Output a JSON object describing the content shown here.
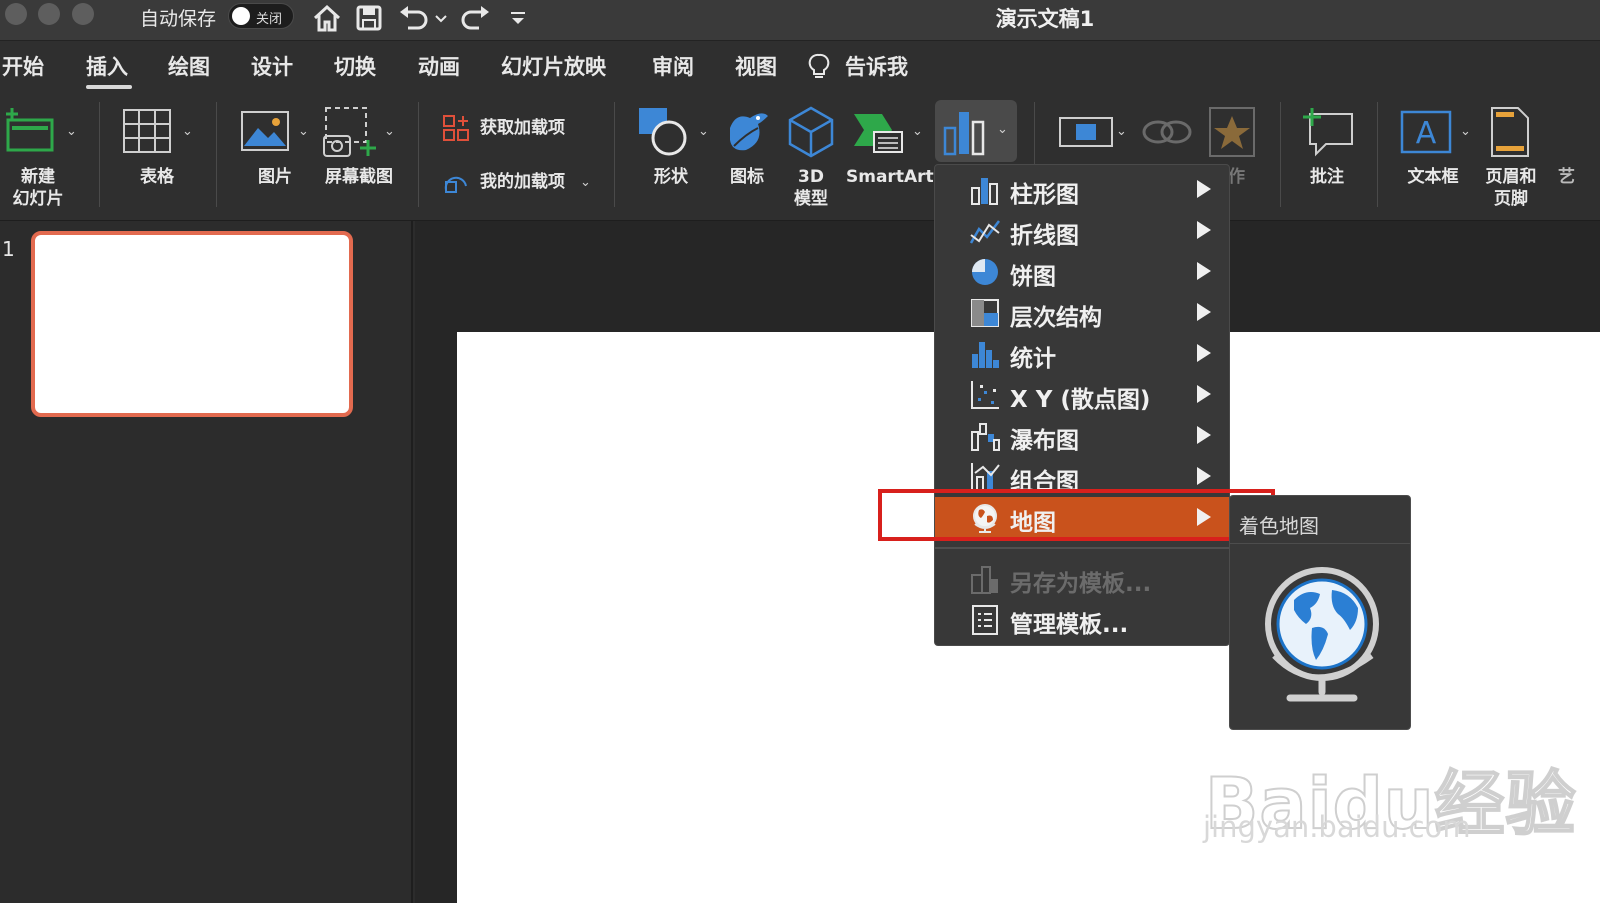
{
  "titlebar": {
    "autosave_label": "自动保存",
    "autosave_toggle": "关闭",
    "doc_title": "演示文稿1"
  },
  "tabs": [
    "开始",
    "插入",
    "绘图",
    "设计",
    "切换",
    "动画",
    "幻灯片放映",
    "审阅",
    "视图",
    "告诉我"
  ],
  "ribbon": {
    "new_slide": "新建\n幻灯片",
    "table": "表格",
    "picture": "图片",
    "screenshot": "屏幕截图",
    "get_addins": "获取加载项",
    "my_addins": "我的加载项",
    "shapes": "形状",
    "icons": "图标",
    "model3d": "3D\n模型",
    "smartart": "SmartArt",
    "action_partial": "作",
    "comment": "批注",
    "textbox": "文本框",
    "header_footer": "页眉和\n页脚",
    "overflow_partial": "艺"
  },
  "slides": {
    "number": "1"
  },
  "chart_menu": {
    "items": [
      {
        "label": "柱形图",
        "icon": "column-chart-icon"
      },
      {
        "label": "折线图",
        "icon": "line-chart-icon"
      },
      {
        "label": "饼图",
        "icon": "pie-chart-icon"
      },
      {
        "label": "层次结构",
        "icon": "hierarchy-chart-icon"
      },
      {
        "label": "统计",
        "icon": "statistic-chart-icon"
      },
      {
        "label": "X Y (散点图)",
        "icon": "scatter-chart-icon"
      },
      {
        "label": "瀑布图",
        "icon": "waterfall-chart-icon"
      },
      {
        "label": "组合图",
        "icon": "combo-chart-icon"
      },
      {
        "label": "地图",
        "icon": "map-chart-icon"
      }
    ],
    "save_template": "另存为模板...",
    "manage_template": "管理模板...",
    "selected": "地图",
    "selected_color": "#c9521c",
    "highlight_color": "#d8201c"
  },
  "submenu": {
    "title": "着色地图",
    "icon": "globe-icon"
  },
  "watermark": {
    "line1": "Baidu经验",
    "line2": "jingyan.baidu.com"
  }
}
